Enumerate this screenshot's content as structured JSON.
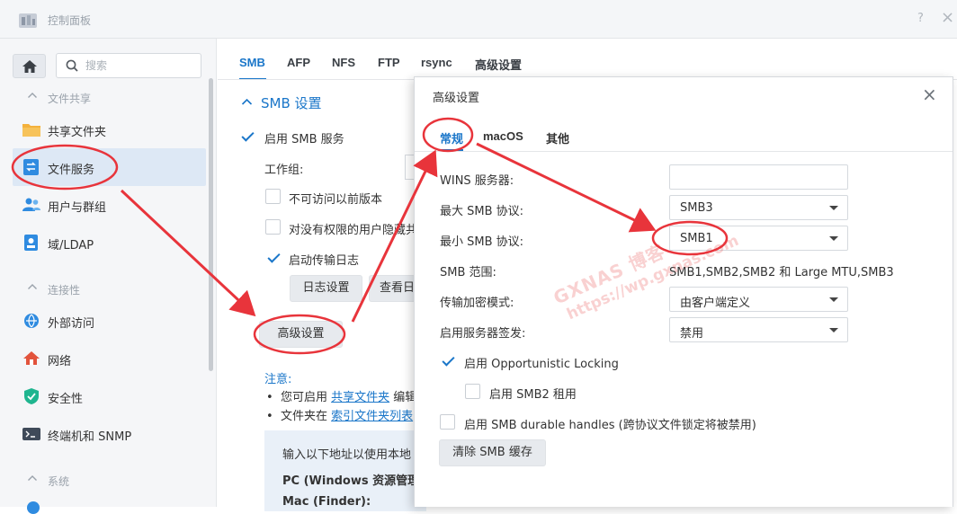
{
  "window": {
    "title": "控制面板",
    "help_glyph": "?",
    "close_glyph": "×"
  },
  "sidebar": {
    "search_placeholder": "搜索",
    "sections": [
      {
        "label": "文件共享",
        "items": [
          {
            "label": "共享文件夹",
            "icon": "folder-icon"
          },
          {
            "label": "文件服务",
            "icon": "file-services-icon",
            "active": true
          },
          {
            "label": "用户与群组",
            "icon": "users-icon"
          },
          {
            "label": "域/LDAP",
            "icon": "domain-icon"
          }
        ]
      },
      {
        "label": "连接性",
        "items": [
          {
            "label": "外部访问",
            "icon": "external-access-icon"
          },
          {
            "label": "网络",
            "icon": "network-icon"
          },
          {
            "label": "安全性",
            "icon": "shield-icon"
          },
          {
            "label": "终端机和 SNMP",
            "icon": "terminal-icon"
          }
        ]
      },
      {
        "label": "系统",
        "items": []
      }
    ]
  },
  "main": {
    "tabs": [
      "SMB",
      "AFP",
      "NFS",
      "FTP",
      "rsync",
      "高级设置"
    ],
    "active_tab": "SMB",
    "section_title": "SMB 设置",
    "enable_smb": "启用 SMB 服务",
    "workgroup_label": "工作组:",
    "no_prev_versions": "不可访问以前版本",
    "hide_unpriv": "对没有权限的用户隐藏共",
    "transfer_log": "启动传输日志",
    "log_settings_btn": "日志设置",
    "view_log_btn": "查看日",
    "advanced_btn": "高级设置",
    "note_title": "注意:",
    "note1_prefix": "您可启用",
    "note1_link": "共享文件夹",
    "note1_suffix": "编辑",
    "note2_prefix": "文件夹在",
    "note2_link": "索引文件夹列表",
    "info_line1": "输入以下地址以使用本地",
    "info_pc": "PC (Windows 资源管理",
    "info_mac": "Mac (Finder):"
  },
  "dialog": {
    "title": "高级设置",
    "close_glyph": "×",
    "tabs": [
      "常规",
      "macOS",
      "其他"
    ],
    "active_tab": "常规",
    "wins_label": "WINS 服务器:",
    "wins_value": "",
    "max_smb_label": "最大 SMB 协议:",
    "max_smb_value": "SMB3",
    "min_smb_label": "最小 SMB 协议:",
    "min_smb_value": "SMB1",
    "smb_range_label": "SMB 范围:",
    "smb_range_value": "SMB1,SMB2,SMB2 和 Large MTU,SMB3",
    "encryption_label": "传输加密模式:",
    "encryption_value": "由客户端定义",
    "signing_label": "启用服务器签发:",
    "signing_value": "禁用",
    "opportunistic_locking": "启用 Opportunistic Locking",
    "opportunistic_locking_checked": true,
    "smb2_lease": "启用 SMB2 租用",
    "smb2_lease_checked": false,
    "durable_handles": "启用 SMB durable handles (跨协议文件锁定将被禁用)",
    "durable_handles_checked": false,
    "clear_cache_btn": "清除 SMB 缓存"
  },
  "watermark": {
    "line1": "GXNAS 博客",
    "line2": "https://wp.gxnas.com"
  },
  "colors": {
    "accent": "#1a76c9",
    "annotation": "#e8343b",
    "sidebar_active": "#dde8f5"
  }
}
